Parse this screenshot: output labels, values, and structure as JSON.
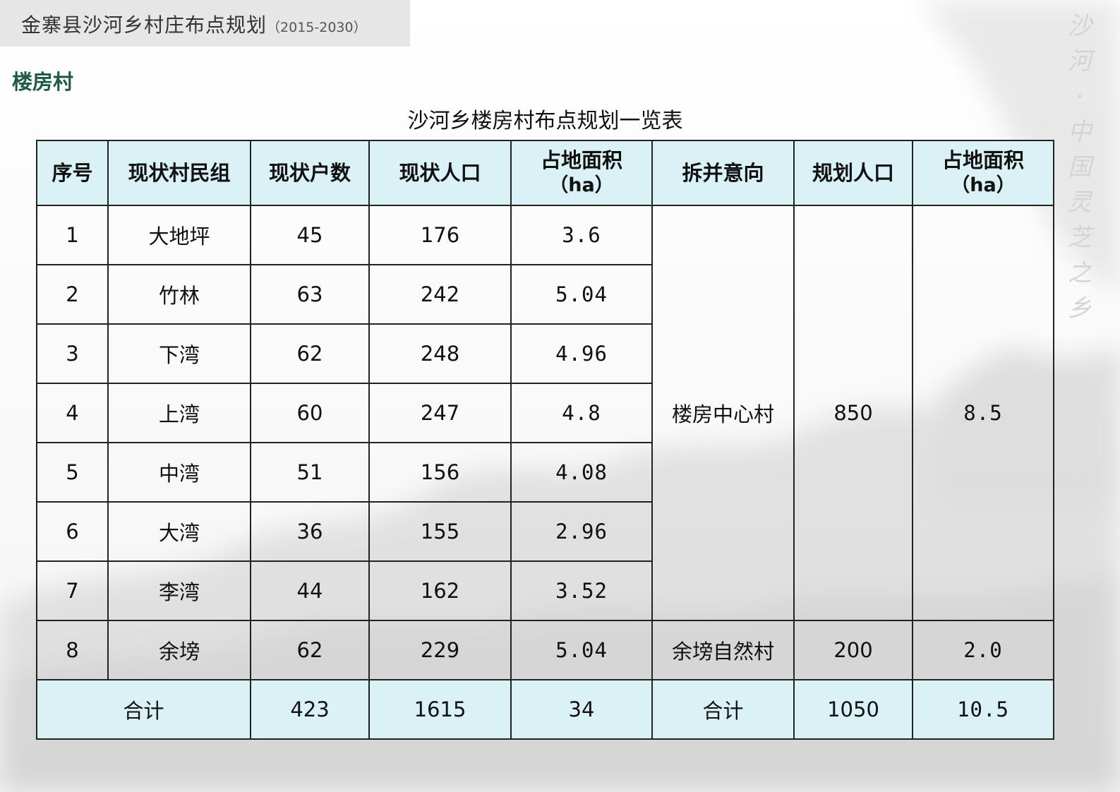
{
  "header": {
    "title": "金寨县沙河乡村庄布点规划",
    "years": "（2015-2030）"
  },
  "village": "楼房村",
  "side_slogan": [
    "沙",
    "河",
    "·",
    "中",
    "国",
    "灵",
    "芝",
    "之",
    "乡"
  ],
  "table": {
    "title": "沙河乡楼房村布点规划一览表",
    "headers": {
      "index": "序号",
      "group": "现状村民组",
      "households": "现状户数",
      "population": "现状人口",
      "area": "占地面积",
      "area_unit": "（ha）",
      "intent": "拆并意向",
      "planned_population": "规划人口",
      "planned_area": "占地面积",
      "planned_area_unit": "（ha）"
    },
    "rows": [
      {
        "index": "1",
        "group": "大地坪",
        "households": "45",
        "population": "176",
        "area": "3.6"
      },
      {
        "index": "2",
        "group": "竹林",
        "households": "63",
        "population": "242",
        "area": "5.04"
      },
      {
        "index": "3",
        "group": "下湾",
        "households": "62",
        "population": "248",
        "area": "4.96"
      },
      {
        "index": "4",
        "group": "上湾",
        "households": "60",
        "population": "247",
        "area": "4.8"
      },
      {
        "index": "5",
        "group": "中湾",
        "households": "51",
        "population": "156",
        "area": "4.08"
      },
      {
        "index": "6",
        "group": "大湾",
        "households": "36",
        "population": "155",
        "area": "2.96"
      },
      {
        "index": "7",
        "group": "李湾",
        "households": "44",
        "population": "162",
        "area": "3.52"
      },
      {
        "index": "8",
        "group": "余塝",
        "households": "62",
        "population": "229",
        "area": "5.04"
      }
    ],
    "merge_groups": [
      {
        "intent": "楼房中心村",
        "planned_population": "850",
        "planned_area": "8.5"
      },
      {
        "intent": "余塝自然村",
        "planned_population": "200",
        "planned_area": "2.0"
      }
    ],
    "totals": {
      "label": "合计",
      "households": "423",
      "population": "1615",
      "area": "34",
      "label2": "合计",
      "planned_population": "1050",
      "planned_area": "10.5"
    }
  }
}
